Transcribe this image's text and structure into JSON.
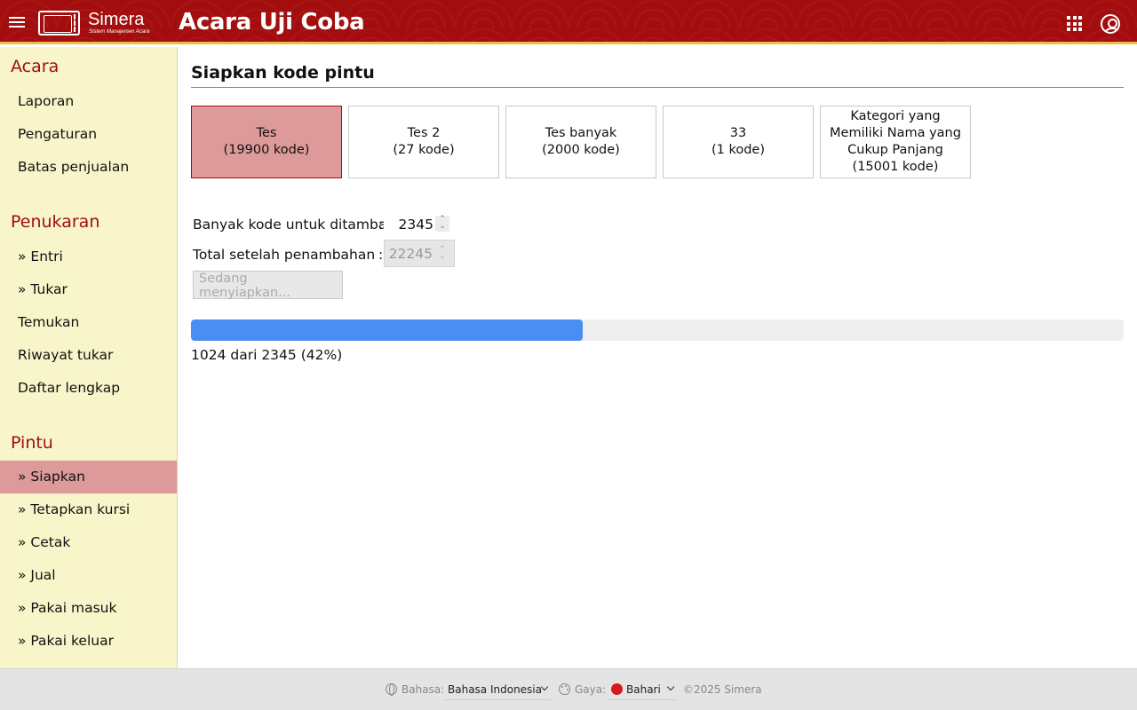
{
  "header": {
    "logo_name": "Simera",
    "logo_tagline": "Sistem Manajemen Acara",
    "title": "Acara Uji Coba"
  },
  "sidebar": {
    "sections": [
      {
        "title": "Acara",
        "items": [
          "Laporan",
          "Pengaturan",
          "Batas penjualan"
        ]
      },
      {
        "title": "Penukaran",
        "items": [
          "» Entri",
          "» Tukar",
          "Temukan",
          "Riwayat tukar",
          "Daftar lengkap"
        ]
      },
      {
        "title": "Pintu",
        "items": [
          "» Siapkan",
          "» Tetapkan kursi",
          "» Cetak",
          "» Jual",
          "» Pakai masuk",
          "» Pakai keluar"
        ]
      }
    ],
    "active_item": "» Siapkan"
  },
  "main": {
    "page_title": "Siapkan kode pintu",
    "categories": [
      {
        "name": "Tes",
        "count": "(19900 kode)",
        "active": true
      },
      {
        "name": "Tes 2",
        "count": "(27 kode)",
        "active": false
      },
      {
        "name": "Tes banyak",
        "count": "(2000 kode)",
        "active": false
      },
      {
        "name": "33",
        "count": "(1 kode)",
        "active": false
      },
      {
        "name": "Kategori yang Memiliki Nama yang Cukup Panjang",
        "count": "(15001 kode)",
        "active": false
      }
    ],
    "form": {
      "add_label": "Banyak kode untuk ditambah",
      "add_value": "2345",
      "total_label": "Total setelah penambahan",
      "total_value": "22245",
      "colon": ":",
      "submit_label": "Sedang menyiapkan..."
    },
    "progress": {
      "done": 1024,
      "total": 2345,
      "percent": 42,
      "fraction": 0.42,
      "text": "1024 dari 2345 (42%)"
    }
  },
  "footer": {
    "language_label": "Bahasa:",
    "language_value": "Bahasa Indonesia",
    "theme_label": "Gaya:",
    "theme_value": "Bahari",
    "theme_color": "#d61a1a",
    "copyright": "©2025 Simera"
  },
  "colors": {
    "header_bg": "#a30d0d",
    "accent_gold": "#e6c04a",
    "sidebar_bg": "#f7f5c9",
    "section_title": "#a30d0d",
    "active_bg": "#dd9a9a",
    "progress_fill": "#4a8df3"
  },
  "icons": [
    "menu-icon",
    "apps-grid-icon",
    "account-icon",
    "globe-icon",
    "palette-icon",
    "chevron-down-icon"
  ]
}
